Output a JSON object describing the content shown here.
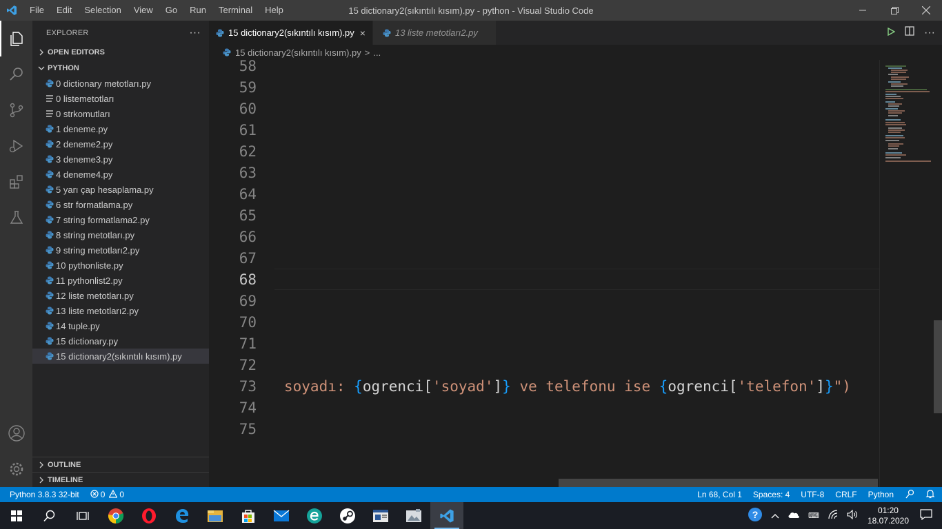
{
  "titlebar": {
    "menu": [
      "File",
      "Edit",
      "Selection",
      "View",
      "Go",
      "Run",
      "Terminal",
      "Help"
    ],
    "title": "15 dictionary2(sıkıntılı kısım).py - python - Visual Studio Code"
  },
  "sidebar": {
    "header": "EXPLORER",
    "more": "···",
    "open_editors": "OPEN EDITORS",
    "folder": "PYTHON",
    "files": [
      {
        "name": "0 dictionary metotları.py",
        "icon": "python"
      },
      {
        "name": "0 listemetotları",
        "icon": "text"
      },
      {
        "name": "0 strkomutları",
        "icon": "text"
      },
      {
        "name": "1 deneme.py",
        "icon": "python"
      },
      {
        "name": "2 deneme2.py",
        "icon": "python"
      },
      {
        "name": "3 deneme3.py",
        "icon": "python"
      },
      {
        "name": "4 deneme4.py",
        "icon": "python"
      },
      {
        "name": "5 yarı çap hesaplama.py",
        "icon": "python"
      },
      {
        "name": "6 str formatlama.py",
        "icon": "python"
      },
      {
        "name": "7 string formatlama2.py",
        "icon": "python"
      },
      {
        "name": "8 string metotları.py",
        "icon": "python"
      },
      {
        "name": "9 string metotları2.py",
        "icon": "python"
      },
      {
        "name": "10 pythonliste.py",
        "icon": "python"
      },
      {
        "name": "11 pythonlist2.py",
        "icon": "python"
      },
      {
        "name": "12 liste metotları.py",
        "icon": "python"
      },
      {
        "name": "13 liste metotları2.py",
        "icon": "python"
      },
      {
        "name": "14 tuple.py",
        "icon": "python"
      },
      {
        "name": "15 dictionary.py",
        "icon": "python"
      },
      {
        "name": "15 dictionary2(sıkıntılı kısım).py",
        "icon": "python"
      }
    ],
    "outline": "OUTLINE",
    "timeline": "TIMELINE"
  },
  "tabs": [
    {
      "label": "15 dictionary2(sıkıntılı kısım).py",
      "close": "×"
    },
    {
      "label": "13 liste metotları2.py"
    }
  ],
  "breadcrumb": {
    "file": "15 dictionary2(sıkıntılı kısım).py",
    "sep": ">",
    "more": "..."
  },
  "editor": {
    "lines": [
      "58",
      "59",
      "60",
      "61",
      "62",
      "63",
      "64",
      "65",
      "66",
      "67",
      "68",
      "69",
      "70",
      "71",
      "72",
      "73",
      "74",
      "75"
    ],
    "code73": {
      "p1": "soyadı: ",
      "b1": "{",
      "id1": "ogrenci[",
      "s1": "'soyad'",
      "id2": "]",
      "b2": "}",
      "p2": " ve telefonu ise ",
      "b3": "{",
      "id3": "ogrenci[",
      "s2": "'telefon'",
      "id4": "]",
      "b4": "}",
      "p3": "\")"
    }
  },
  "status": {
    "interpreter": "Python 3.8.3 32-bit",
    "errors": "0",
    "warnings": "0",
    "position": "Ln 68, Col 1",
    "spaces": "Spaces: 4",
    "encoding": "UTF-8",
    "eol": "CRLF",
    "language": "Python"
  },
  "taskbar": {
    "time": "01:20",
    "date": "18.07.2020"
  },
  "colors": {
    "accent": "#007acc",
    "string": "#ce9178",
    "brace": "#179fff"
  }
}
